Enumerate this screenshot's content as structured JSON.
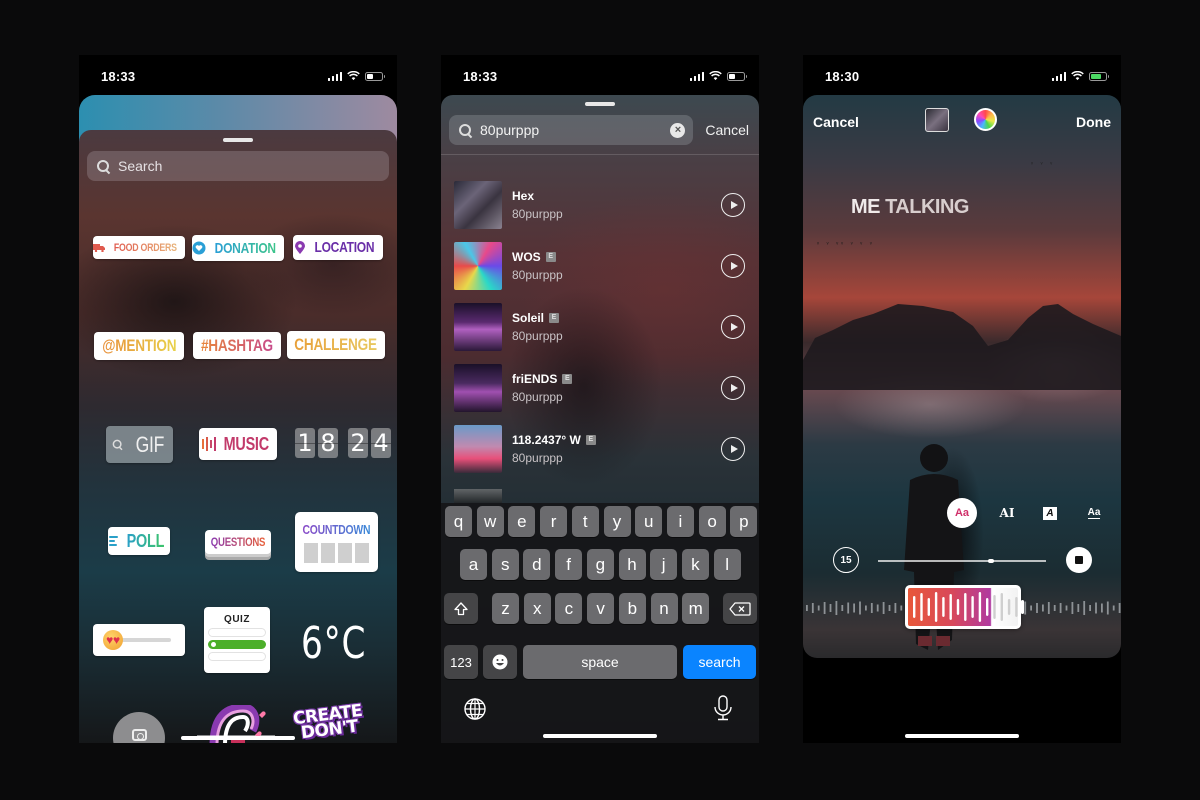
{
  "colors": {
    "background": "#0a0a0b",
    "keyboard_search_key": "#0a84ff",
    "quiz_correct": "#4caf2a",
    "font_style_active": "#d0306a",
    "audio_selection_start": "#e8583a",
    "audio_selection_end": "#b03aa0"
  },
  "phone1": {
    "status": {
      "time": "18:33",
      "battery_level": 0.4,
      "charging": false
    },
    "search": {
      "placeholder": "Search",
      "icon": "search-icon"
    },
    "stickers": {
      "food_orders": "FOOD ORDERS",
      "donation": "DONATION",
      "location": "LOCATION",
      "mention": "@MENTION",
      "hashtag": "#HASHTAG",
      "challenge": "CHALLENGE",
      "gif": "GIF",
      "music": "MUSIC",
      "clock_digits": [
        "1",
        "8",
        "2",
        "4"
      ],
      "poll": "POLL",
      "questions": "QUESTIONS",
      "countdown": "COUNTDOWN",
      "emoji_slider": "😍",
      "quiz": "QUIZ",
      "quiz_correct_option": 2,
      "temperature": "6°C",
      "create": "CREATE",
      "dont": "DON'T"
    }
  },
  "phone2": {
    "status": {
      "time": "18:33",
      "battery_level": 0.4,
      "charging": false
    },
    "search": {
      "value": "80purppp",
      "cancel_label": "Cancel",
      "clear_icon": "clear-icon"
    },
    "tracks": [
      {
        "title": "Hex",
        "artist": "80purppp",
        "explicit": false
      },
      {
        "title": "WOS",
        "artist": "80purppp",
        "explicit": true
      },
      {
        "title": "Soleil",
        "artist": "80purppp",
        "explicit": true
      },
      {
        "title": "friENDS",
        "artist": "80purppp",
        "explicit": true
      },
      {
        "title": "118.2437° W",
        "artist": "80purppp",
        "explicit": true
      }
    ],
    "explicit_badge": "E",
    "keyboard": {
      "row1": [
        "q",
        "w",
        "e",
        "r",
        "t",
        "y",
        "u",
        "i",
        "o",
        "p"
      ],
      "row2": [
        "a",
        "s",
        "d",
        "f",
        "g",
        "h",
        "j",
        "k",
        "l"
      ],
      "row3": [
        "z",
        "x",
        "c",
        "v",
        "b",
        "n",
        "m"
      ],
      "numbers_label": "123",
      "emoji_label": "☻",
      "space_label": "space",
      "search_label": "search"
    }
  },
  "phone3": {
    "status": {
      "time": "18:30",
      "battery_level": 0.7,
      "charging": true
    },
    "header": {
      "cancel_label": "Cancel",
      "done_label": "Done"
    },
    "caption": {
      "bold": "ME",
      "rest": "TALKING"
    },
    "font_styles": [
      "Aa",
      "AI",
      "A",
      "Aa"
    ],
    "active_font_style": 0,
    "duration_label": "15",
    "scrub_position": 0.67,
    "audio_selection": {
      "start": 0.32,
      "end": 0.68
    }
  }
}
